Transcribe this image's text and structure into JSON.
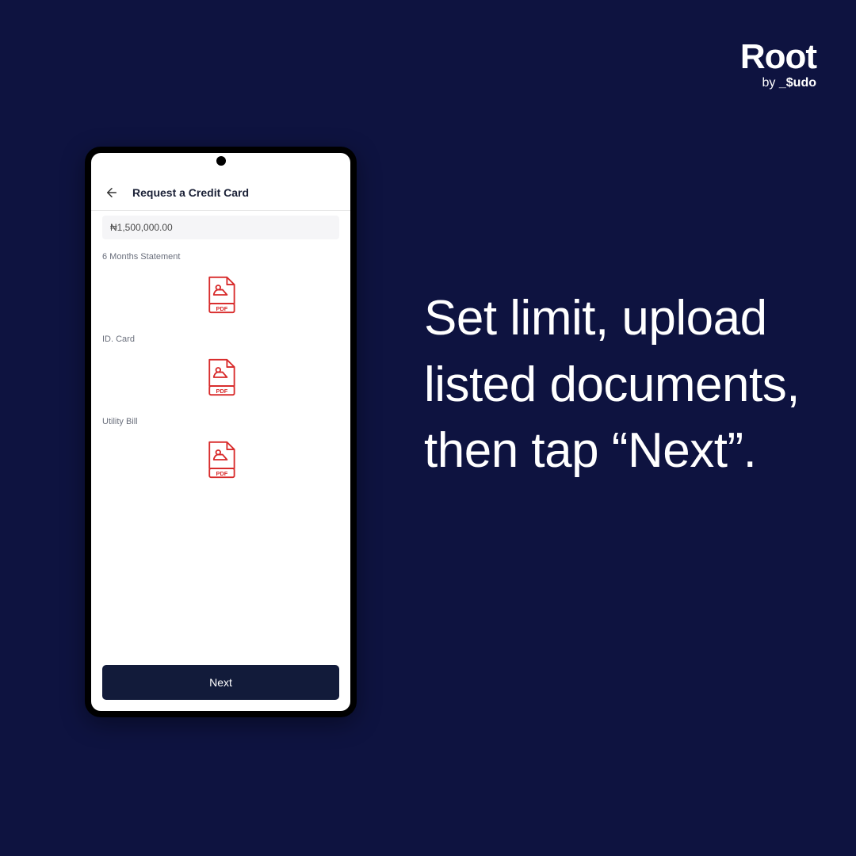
{
  "brand": {
    "name": "Root",
    "byline_prefix": "by ",
    "byline_brand": "_$udo"
  },
  "instruction": "Set limit, upload listed documents, then tap “Next”.",
  "app": {
    "title": "Request a Credit Card",
    "amount": "₦1,500,000.00",
    "sections": [
      {
        "label": "6 Months Statement",
        "file_type": "PDF"
      },
      {
        "label": "ID. Card",
        "file_type": "PDF"
      },
      {
        "label": "Utility Bill",
        "file_type": "PDF"
      }
    ],
    "next_label": "Next"
  },
  "colors": {
    "background": "#0e1340",
    "pdf_red": "#d82a2a",
    "button": "#121b3a"
  }
}
